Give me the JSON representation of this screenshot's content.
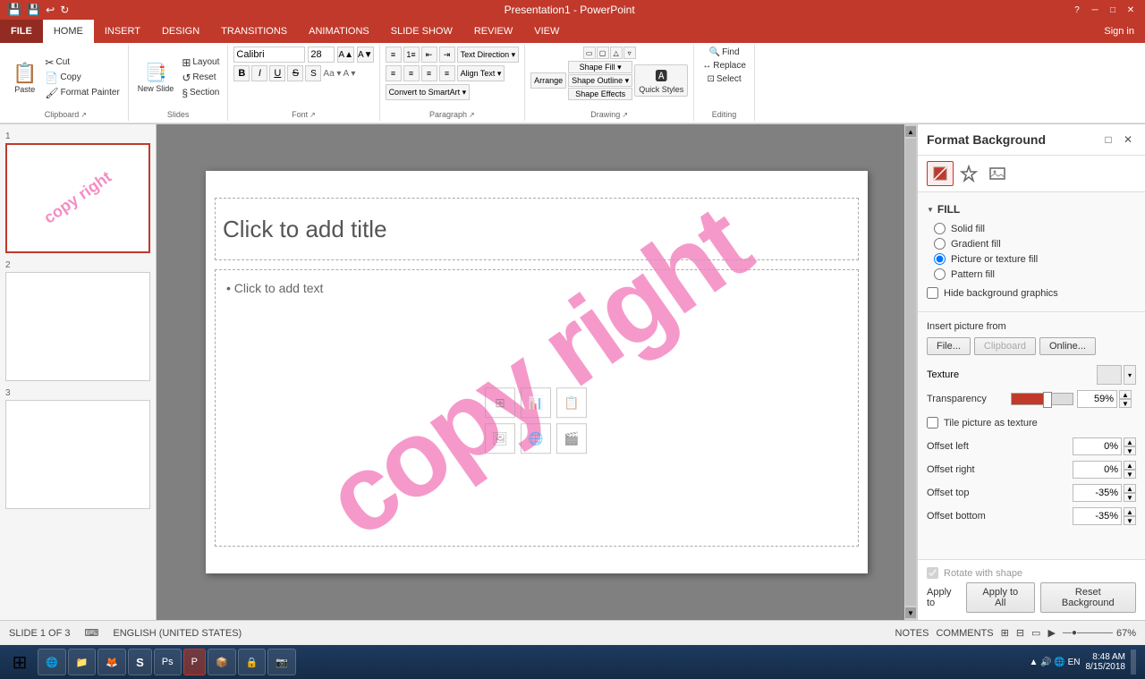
{
  "titlebar": {
    "title": "Presentation1 - PowerPoint",
    "help_btn": "?",
    "min_btn": "─",
    "max_btn": "□",
    "close_btn": "✕"
  },
  "ribbon": {
    "tabs": [
      {
        "id": "file",
        "label": "FILE"
      },
      {
        "id": "home",
        "label": "HOME",
        "active": true
      },
      {
        "id": "insert",
        "label": "INSERT"
      },
      {
        "id": "design",
        "label": "DESIGN"
      },
      {
        "id": "transitions",
        "label": "TRANSITIONS"
      },
      {
        "id": "animations",
        "label": "ANIMATIONS"
      },
      {
        "id": "slideshow",
        "label": "SLIDE SHOW"
      },
      {
        "id": "review",
        "label": "REVIEW"
      },
      {
        "id": "view",
        "label": "VIEW"
      }
    ],
    "groups": {
      "clipboard": {
        "label": "Clipboard",
        "paste_label": "Paste",
        "cut_label": "Cut",
        "copy_label": "Copy",
        "format_painter_label": "Format Painter"
      },
      "slides": {
        "label": "Slides",
        "new_slide_label": "New Slide",
        "layout_label": "Layout",
        "reset_label": "Reset",
        "section_label": "Section"
      },
      "font": {
        "label": "Font",
        "font_name": "Calibri",
        "font_size": "28"
      },
      "paragraph": {
        "label": "Paragraph",
        "text_direction_label": "Text Direction"
      },
      "drawing": {
        "label": "Drawing",
        "arrange_label": "Arrange",
        "quick_styles_label": "Quick Styles",
        "shape_fill_label": "Shape Fill",
        "shape_outline_label": "Shape Outline",
        "shape_effects_label": "Shape Effects"
      },
      "editing": {
        "label": "Editing",
        "find_label": "Find",
        "replace_label": "Replace",
        "select_label": "Select"
      }
    }
  },
  "slide_panel": {
    "slides": [
      {
        "num": "1",
        "active": true
      },
      {
        "num": "2",
        "active": false
      },
      {
        "num": "3",
        "active": false
      }
    ]
  },
  "slide": {
    "title_placeholder": "Click to add title",
    "content_placeholder": "• Click to add text",
    "watermark": "copy right"
  },
  "format_panel": {
    "title": "Format Background",
    "icons": [
      "🪣",
      "⬡",
      "🖼"
    ],
    "fill_label": "FILL",
    "fill_options": [
      {
        "id": "solid",
        "label": "Solid fill"
      },
      {
        "id": "gradient",
        "label": "Gradient fill"
      },
      {
        "id": "picture",
        "label": "Picture or texture fill",
        "checked": true
      },
      {
        "id": "pattern",
        "label": "Pattern fill"
      }
    ],
    "hide_bg_label": "Hide background graphics",
    "insert_picture_label": "Insert picture from",
    "file_btn": "File...",
    "clipboard_btn": "Clipboard",
    "online_btn": "Online...",
    "texture_label": "Texture",
    "transparency_label": "Transparency",
    "transparency_value": "59%",
    "tile_label": "Tile picture as texture",
    "offset_left_label": "Offset left",
    "offset_left_value": "0%",
    "offset_right_label": "Offset right",
    "offset_right_value": "0%",
    "offset_top_label": "Offset top",
    "offset_top_value": "-35%",
    "offset_bottom_label": "Offset bottom",
    "offset_bottom_value": "-35%",
    "rotate_label": "Rotate with shape",
    "apply_to_label": "Apply to",
    "apply_all_btn": "Apply to All",
    "reset_btn": "Reset Background"
  },
  "statusbar": {
    "slide_info": "SLIDE 1 OF 3",
    "language": "ENGLISH (UNITED STATES)",
    "notes_label": "NOTES",
    "comments_label": "COMMENTS",
    "zoom": "67%"
  },
  "taskbar": {
    "time": "8:48 AM",
    "date": "8/15/2018",
    "apps": [
      "🪟",
      "🌐",
      "📁",
      "🦊",
      "S",
      "📝",
      "🐧",
      "P",
      "📦",
      "🔒",
      "📷"
    ]
  }
}
